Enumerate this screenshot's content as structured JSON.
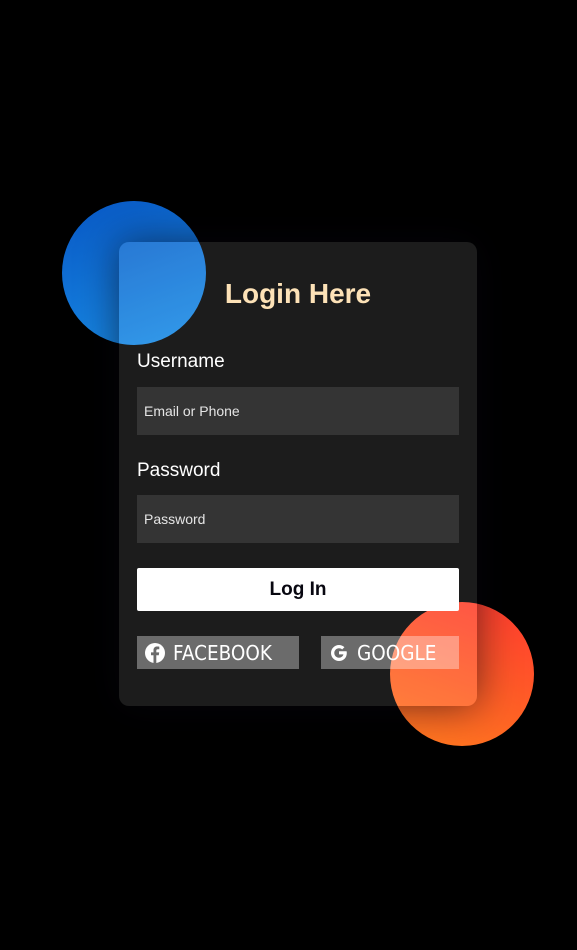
{
  "login_form": {
    "title": "Login Here",
    "username_label": "Username",
    "username_placeholder": "Email or Phone",
    "password_label": "Password",
    "password_placeholder": "Password",
    "submit_label": "Log In"
  },
  "social": {
    "facebook_label": "Facebook",
    "facebook_icon": "facebook-icon",
    "google_label": "Google",
    "google_icon": "google-icon"
  },
  "colors": {
    "background": "#000000",
    "title": "#fde2b7",
    "blue_shape": "#1a8fe8",
    "orange_shape": "#ff5a26"
  }
}
